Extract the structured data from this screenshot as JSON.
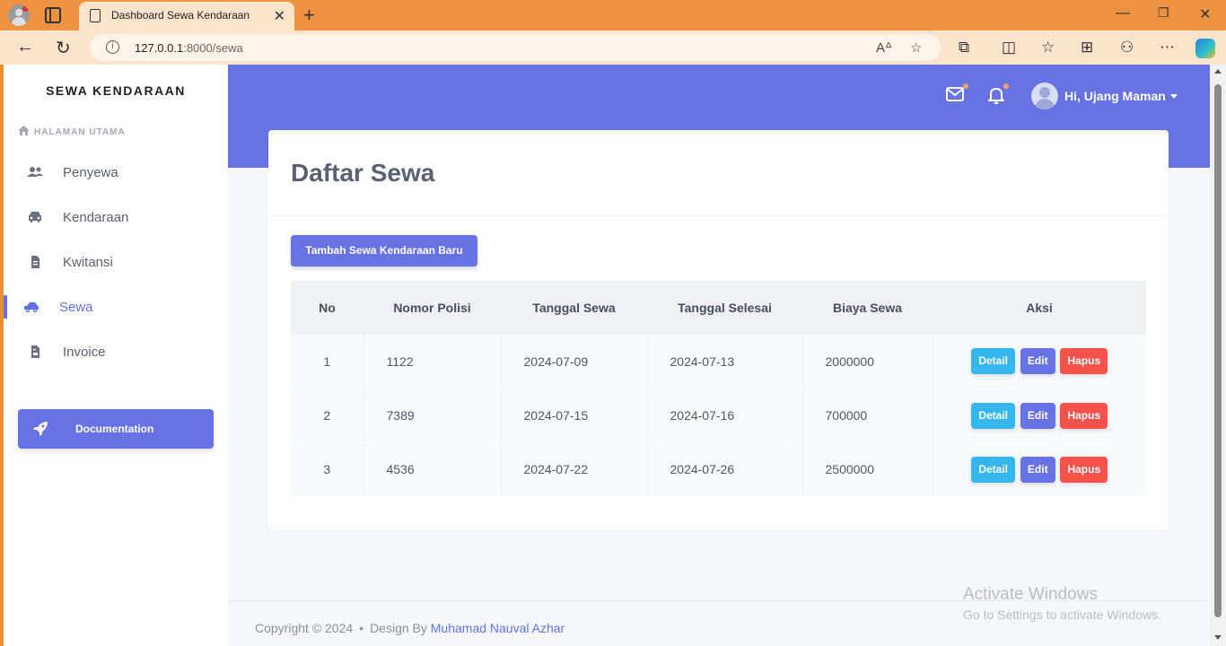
{
  "browser": {
    "tab_title": "Dashboard Sewa Kendaraan",
    "url_host": "127.0.0.1",
    "url_path": ":8000/sewa"
  },
  "sidebar": {
    "brand": "SEWA KENDARAAN",
    "section": "HALAMAN UTAMA",
    "items": [
      {
        "label": "Penyewa",
        "icon": "users-icon"
      },
      {
        "label": "Kendaraan",
        "icon": "car-icon"
      },
      {
        "label": "Kwitansi",
        "icon": "file-icon"
      },
      {
        "label": "Sewa",
        "icon": "car-icon",
        "active": true
      },
      {
        "label": "Invoice",
        "icon": "file-invoice-icon"
      }
    ],
    "doc_button": "Documentation"
  },
  "header": {
    "user": "Hi, Ujang Maman"
  },
  "main": {
    "title": "Daftar Sewa",
    "add_button": "Tambah Sewa Kendaraan Baru",
    "table": {
      "headers": [
        "No",
        "Nomor Polisi",
        "Tanggal Sewa",
        "Tanggal Selesai",
        "Biaya Sewa",
        "Aksi"
      ],
      "rows": [
        [
          "1",
          "1122",
          "2024-07-09",
          "2024-07-13",
          "2000000"
        ],
        [
          "2",
          "7389",
          "2024-07-15",
          "2024-07-16",
          "700000"
        ],
        [
          "3",
          "4536",
          "2024-07-22",
          "2024-07-26",
          "2500000"
        ]
      ],
      "actions": {
        "detail": "Detail",
        "edit": "Edit",
        "hapus": "Hapus"
      }
    }
  },
  "footer": {
    "copyright": "Copyright © 2024",
    "design_by": "Design By",
    "author": "Muhamad Nauval Azhar"
  },
  "watermark": {
    "line1": "Activate Windows",
    "line2": "Go to Settings to activate Windows."
  },
  "colors": {
    "primary": "#6772e5",
    "info": "#35b7ee",
    "danger": "#f5524c",
    "browser_accent": "#ec9240"
  }
}
